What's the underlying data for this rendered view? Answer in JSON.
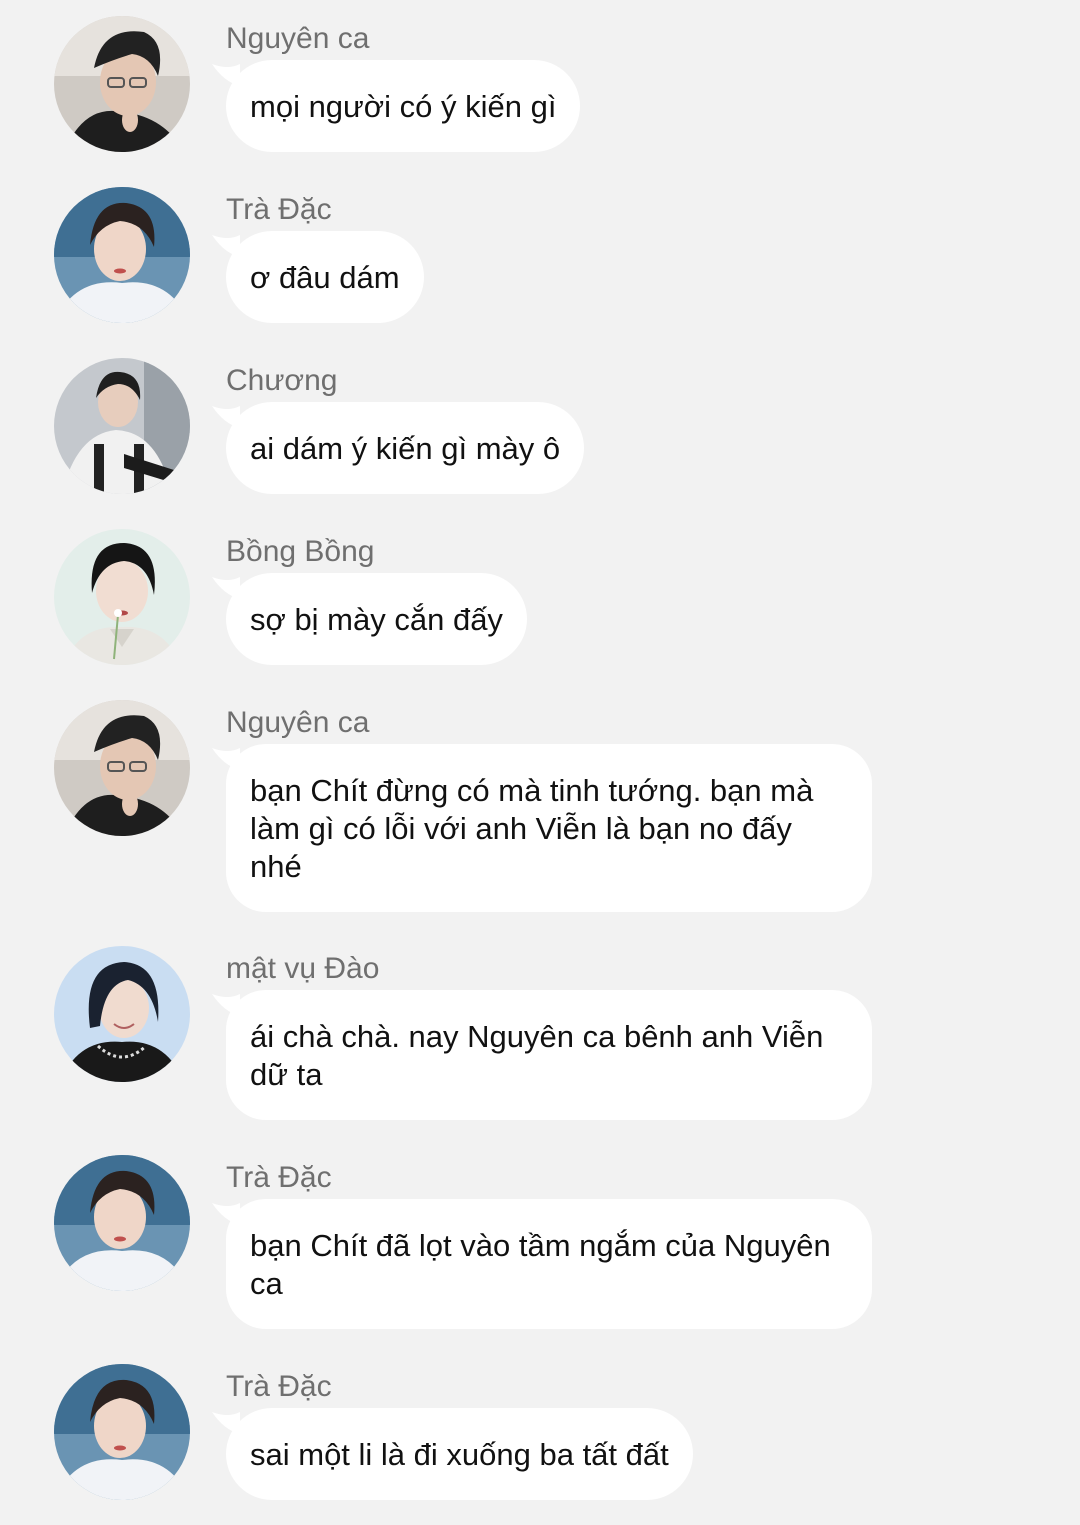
{
  "messages": [
    {
      "sender": "Nguyên ca",
      "text": "mọi người có ý kiến gì",
      "avatar": "avatar-nguyen-ca"
    },
    {
      "sender": "Trà Đặc",
      "text": "ơ đâu dám",
      "avatar": "avatar-tra-dac"
    },
    {
      "sender": "Chương",
      "text": "ai dám ý kiến gì mày ô",
      "avatar": "avatar-chuong"
    },
    {
      "sender": "Bồng Bồng",
      "text": "sợ bị mày cắn đấy",
      "avatar": "avatar-bong-bong"
    },
    {
      "sender": "Nguyên ca",
      "text": "bạn Chít đừng có mà tinh tướng. bạn mà làm gì có lỗi với anh Viễn là bạn no đấy nhé",
      "avatar": "avatar-nguyen-ca"
    },
    {
      "sender": "mật vụ Đào",
      "text": "ái chà chà. nay Nguyên ca bênh anh Viễn dữ ta",
      "avatar": "avatar-mat-vu-dao"
    },
    {
      "sender": "Trà Đặc",
      "text": "bạn Chít đã lọt vào tầm ngắm của Nguyên ca",
      "avatar": "avatar-tra-dac"
    },
    {
      "sender": "Trà Đặc",
      "text": "sai một li là đi xuống ba tất đất",
      "avatar": "avatar-tra-dac"
    }
  ],
  "colors": {
    "background": "#f2f2f2",
    "bubble": "#ffffff",
    "sender_name": "#6f6f6f",
    "message_text": "#111111"
  }
}
